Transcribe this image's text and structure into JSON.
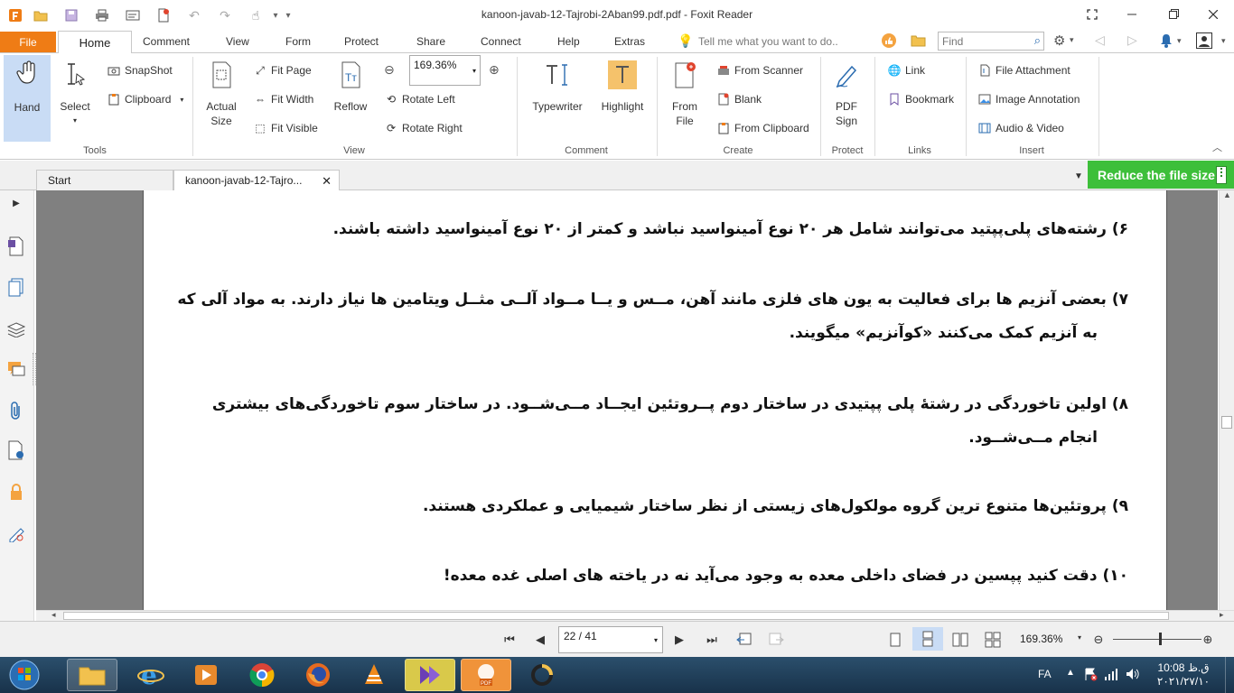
{
  "window": {
    "title": "kanoon-javab-12-Tajrobi-2Aban99.pdf.pdf - Foxit Reader"
  },
  "menu": {
    "file": "File",
    "tabs": [
      "Home",
      "Comment",
      "View",
      "Form",
      "Protect",
      "Share",
      "Connect",
      "Help",
      "Extras"
    ],
    "tell_me": "Tell me what you want to do..",
    "find_placeholder": "Find"
  },
  "ribbon": {
    "tools": {
      "label": "Tools",
      "hand": "Hand",
      "select": "Select",
      "snapshot": "SnapShot",
      "clipboard": "Clipboard"
    },
    "view": {
      "label": "View",
      "actual_size": [
        "Actual",
        "Size"
      ],
      "fit_page": "Fit Page",
      "fit_width": "Fit Width",
      "fit_visible": "Fit Visible",
      "reflow": "Reflow",
      "zoom_value": "169.36%",
      "rotate_left": "Rotate Left",
      "rotate_right": "Rotate Right"
    },
    "comment": {
      "label": "Comment",
      "typewriter": "Typewriter",
      "highlight": "Highlight"
    },
    "create": {
      "label": "Create",
      "from_file": [
        "From",
        "File"
      ],
      "from_scanner": "From Scanner",
      "blank": "Blank",
      "from_clipboard": "From Clipboard"
    },
    "protect": {
      "label": "Protect",
      "pdf_sign": [
        "PDF",
        "Sign"
      ]
    },
    "links": {
      "label": "Links",
      "link": "Link",
      "bookmark": "Bookmark"
    },
    "insert": {
      "label": "Insert",
      "file_attachment": "File Attachment",
      "image_annotation": "Image Annotation",
      "audio_video": "Audio & Video"
    }
  },
  "tabs": {
    "start": "Start",
    "doc": "kanoon-javab-12-Tajro...",
    "reduce": "Reduce the file size"
  },
  "document": {
    "paragraphs": [
      "۶)  رشته‌های پلی‌پپتید می‌توانند شامل هر ۲۰ نوع آمینواسید نباشد و کمتر از ۲۰ نوع آمینواسید داشته باشند.",
      "۷)  بعضی آنزیم ها برای فعالیت به یون های فلزی مانند آهن، مــس و یــا مــواد آلــی مثــل ویتامین ها نیاز دارند. به مواد آلی که",
      "به آنزیم کمک می‌کنند «کوآنزیم» میگویند.",
      "۸)  اولین تاخوردگی در رشتهٔ پلی پپتیدی در ساختار دوم پــروتئین ایجــاد مــی‌شــود. در ساختار سوم تاخوردگی‌های بیشتری",
      "انجام مــی‌شــود.",
      "۹)  پروتئین‌ها متنوع ترین گروه مولکول‌های زیستی از نظر ساختار شیمیایی و عملکردی هستند.",
      "۱۰)  دقت کنید پپسین در فضای داخلی معده به وجود می‌آید نه در یاخته های اصلی غده معده!"
    ]
  },
  "statusbar": {
    "page": "22 / 41",
    "zoom": "169.36%"
  },
  "taskbar": {
    "lang": "FA",
    "time": "10:08 ق.ظ",
    "date": "۲۰۲۱/۲۷/۱۰"
  },
  "colors": {
    "file_tab": "#ef7c15",
    "reduce_banner": "#3dbf3a",
    "hand_active": "#c9dcf5",
    "doc_background": "#808080"
  }
}
